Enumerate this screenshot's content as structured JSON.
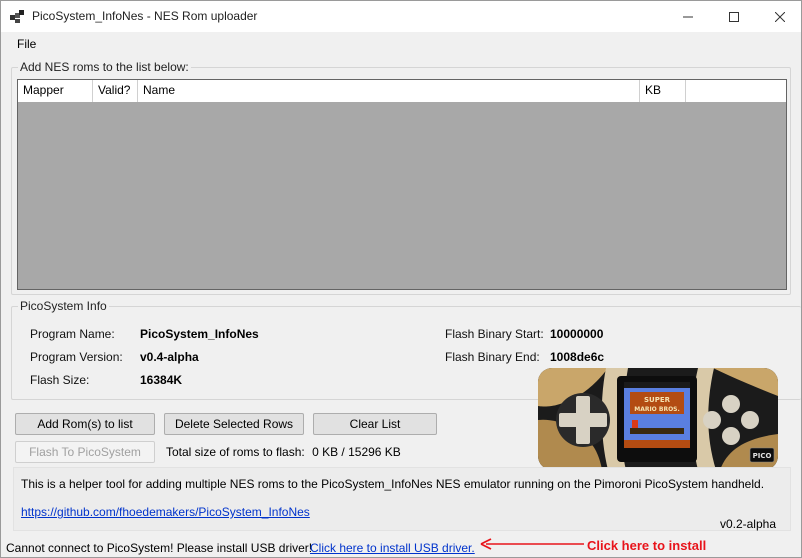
{
  "window": {
    "title": "PicoSystem_InfoNes - NES Rom uploader",
    "minimize_icon": "minimize-icon",
    "maximize_icon": "maximize-icon",
    "close_icon": "close-icon"
  },
  "menu": {
    "file": "File"
  },
  "roms": {
    "group_title": "Add NES roms to the list below:",
    "columns": [
      "Mapper",
      "Valid?",
      "Name",
      "KB",
      ""
    ],
    "rows": []
  },
  "info": {
    "group_title": "PicoSystem Info",
    "program_name_label": "Program Name:",
    "program_name": "PicoSystem_InfoNes",
    "program_version_label": "Program Version:",
    "program_version": "v0.4-alpha",
    "flash_size_label": "Flash Size:",
    "flash_size": "16384K",
    "flash_start_label": "Flash Binary Start:",
    "flash_start": "10000000",
    "flash_end_label": "Flash Binary End:",
    "flash_end": "1008de6c"
  },
  "buttons": {
    "add_roms": "Add Rom(s) to list",
    "delete_rows": "Delete Selected Rows",
    "clear_list": "Clear List",
    "flash": "Flash To PicoSystem"
  },
  "total": {
    "label": "Total size of roms to flash:",
    "value": "0 KB / 15296 KB"
  },
  "help": {
    "text": "This is a helper tool for adding multiple NES roms to the PicoSystem_InfoNes NES emulator running on the Pimoroni PicoSystem handheld.",
    "link": "https://github.com/fhoedemakers/PicoSystem_InfoNes",
    "version": "v0.2-alpha"
  },
  "status": {
    "message": "Cannot connect to PicoSystem! Please install USB driver!",
    "link": "Click here to install USB driver.",
    "annotation": "Click here to install"
  },
  "device_image": {
    "screen_title_line1": "SUPER",
    "screen_title_line2": "MARIO BROS.",
    "logo": "PICO"
  },
  "colors": {
    "accent_link": "#0033cc",
    "annotation_red": "#e8141b",
    "grid_background": "#a8a8a8"
  }
}
